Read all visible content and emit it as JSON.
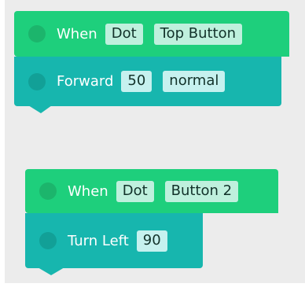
{
  "blocks": {
    "group1": {
      "event": {
        "label": "When",
        "device": "Dot",
        "trigger": "Top Button",
        "color": "#1ecf7c"
      },
      "action": {
        "label": "Forward",
        "amount": "50",
        "speed": "normal",
        "color": "#17b6ae"
      }
    },
    "group2": {
      "event": {
        "label": "When",
        "device": "Dot",
        "trigger": "Button 2",
        "color": "#1ecf7c"
      },
      "action": {
        "label": "Turn Left",
        "amount": "90",
        "color": "#17b6ae"
      }
    }
  }
}
